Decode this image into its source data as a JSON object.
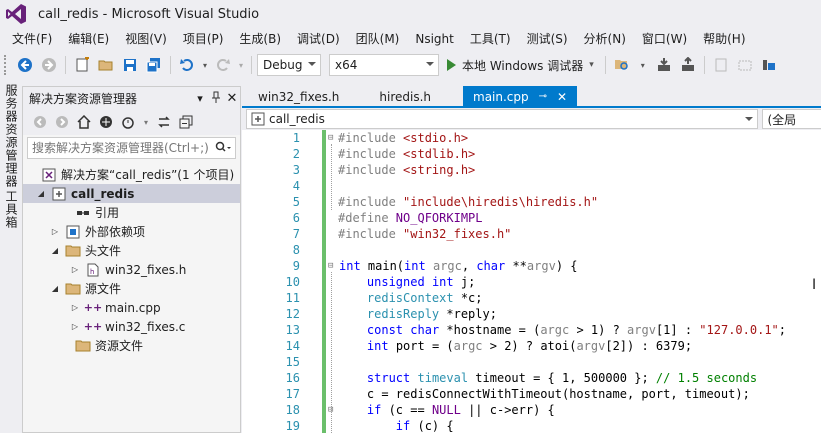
{
  "window": {
    "title": "call_redis - Microsoft Visual Studio"
  },
  "menu": [
    "文件(F)",
    "编辑(E)",
    "视图(V)",
    "项目(P)",
    "生成(B)",
    "调试(D)",
    "团队(M)",
    "Nsight",
    "工具(T)",
    "测试(S)",
    "分析(N)",
    "窗口(W)",
    "帮助(H)"
  ],
  "toolbar": {
    "config": "Debug",
    "platform": "x64",
    "run_label": "本地 Windows 调试器"
  },
  "left_strip": {
    "tab1": "服务器资源管理器",
    "tab2": "工具箱"
  },
  "solution_explorer": {
    "title": "解决方案资源管理器",
    "search_placeholder": "搜索解决方案资源管理器(Ctrl+;)",
    "tree": [
      {
        "label": "解决方案“call_redis”(1 个项目)",
        "icon": "solution-icon"
      },
      {
        "label": "call_redis",
        "icon": "project-icon",
        "selected": true
      },
      {
        "label": "引用",
        "icon": "references-icon"
      },
      {
        "label": "外部依赖项",
        "icon": "external-deps-icon"
      },
      {
        "label": "头文件",
        "icon": "folder-icon"
      },
      {
        "label": "win32_fixes.h",
        "icon": "header-file-icon"
      },
      {
        "label": "源文件",
        "icon": "folder-icon"
      },
      {
        "label": "main.cpp",
        "icon": "cpp-file-icon"
      },
      {
        "label": "win32_fixes.c",
        "icon": "cpp-file-icon"
      },
      {
        "label": "资源文件",
        "icon": "folder-icon"
      }
    ]
  },
  "tabs": [
    {
      "label": "win32_fixes.h",
      "active": false
    },
    {
      "label": "hiredis.h",
      "active": false
    },
    {
      "label": "main.cpp",
      "active": true
    }
  ],
  "navbar": {
    "scope": "call_redis",
    "right": "(全局"
  },
  "editor": {
    "line_numbers": [
      "1",
      "2",
      "3",
      "4",
      "5",
      "6",
      "7",
      "8",
      "9",
      "10",
      "11",
      "12",
      "13",
      "14",
      "15",
      "16",
      "17",
      "18",
      "19"
    ]
  }
}
